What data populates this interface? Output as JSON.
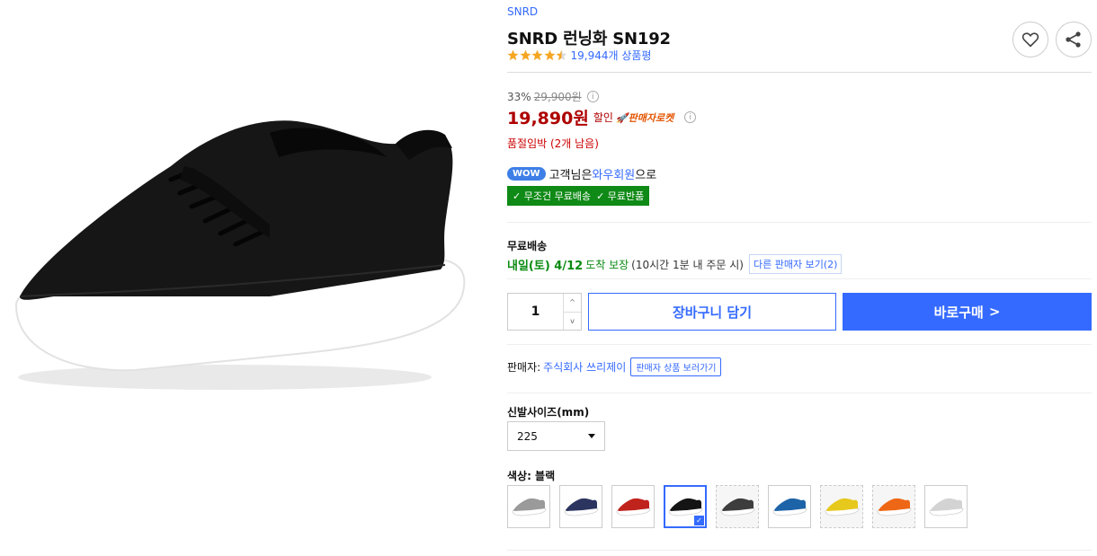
{
  "product": {
    "brand": "SNRD",
    "title": "SNRD 런닝화 SN192",
    "rating": 4.5,
    "review_count": "19,944개 상품평",
    "image": "black-mesh-running-shoe"
  },
  "price": {
    "discount_rate": "33%",
    "original": "29,900원",
    "info_mark": "i",
    "sale_price": "19,890원",
    "sale_label": "할인",
    "rocket_label": "🚀판매자로켓",
    "stock_notice": "품절임박 (2개 남음)"
  },
  "wow": {
    "badge": "WOW",
    "text_prefix": "고객님은 ",
    "member": "와우회원",
    "text_suffix": "으로",
    "benefit_1": "✓ 무조건 무료배송",
    "benefit_2": "✓ 무료반품"
  },
  "shipping": {
    "title": "무료배송",
    "date": "내일(토) 4/12",
    "guarantee": "도착 보장",
    "condition": "(10시간 1분 내 주문 시)",
    "other_sellers": "다른 판매자 보기(2)"
  },
  "purchase": {
    "quantity": "1",
    "up": "^",
    "down": "v",
    "cart_label": "장바구니 담기",
    "buy_label": "바로구매",
    "buy_arrow": ">"
  },
  "seller": {
    "prefix": "판매자:",
    "name": "주식회사 쓰리제이",
    "products_link": "판매자 상품 보러가기"
  },
  "options": {
    "size_label": "신발사이즈(mm)",
    "size_value": "225",
    "color_label": "색상: 블랙",
    "colors": [
      {
        "color": "#9a9a9a",
        "soldout": false,
        "selected": false
      },
      {
        "color": "#2c3460",
        "soldout": false,
        "selected": false
      },
      {
        "color": "#c0221c",
        "soldout": false,
        "selected": false
      },
      {
        "color": "#141414",
        "soldout": false,
        "selected": true
      },
      {
        "color": "#3d3d3d",
        "soldout": true,
        "selected": false
      },
      {
        "color": "#1d63a8",
        "soldout": false,
        "selected": false
      },
      {
        "color": "#e7c81c",
        "soldout": true,
        "selected": false
      },
      {
        "color": "#ee6716",
        "soldout": true,
        "selected": false
      },
      {
        "color": "#d3d3d3",
        "soldout": false,
        "selected": false
      }
    ],
    "check_mark": "✓"
  },
  "colors": {
    "accent": "#346aff",
    "price_red": "#ae0000",
    "rocket_orange": "#e35400",
    "delivery_green": "#0a8a11",
    "wow_green": "#0f8a16",
    "star": "#f5a623"
  }
}
